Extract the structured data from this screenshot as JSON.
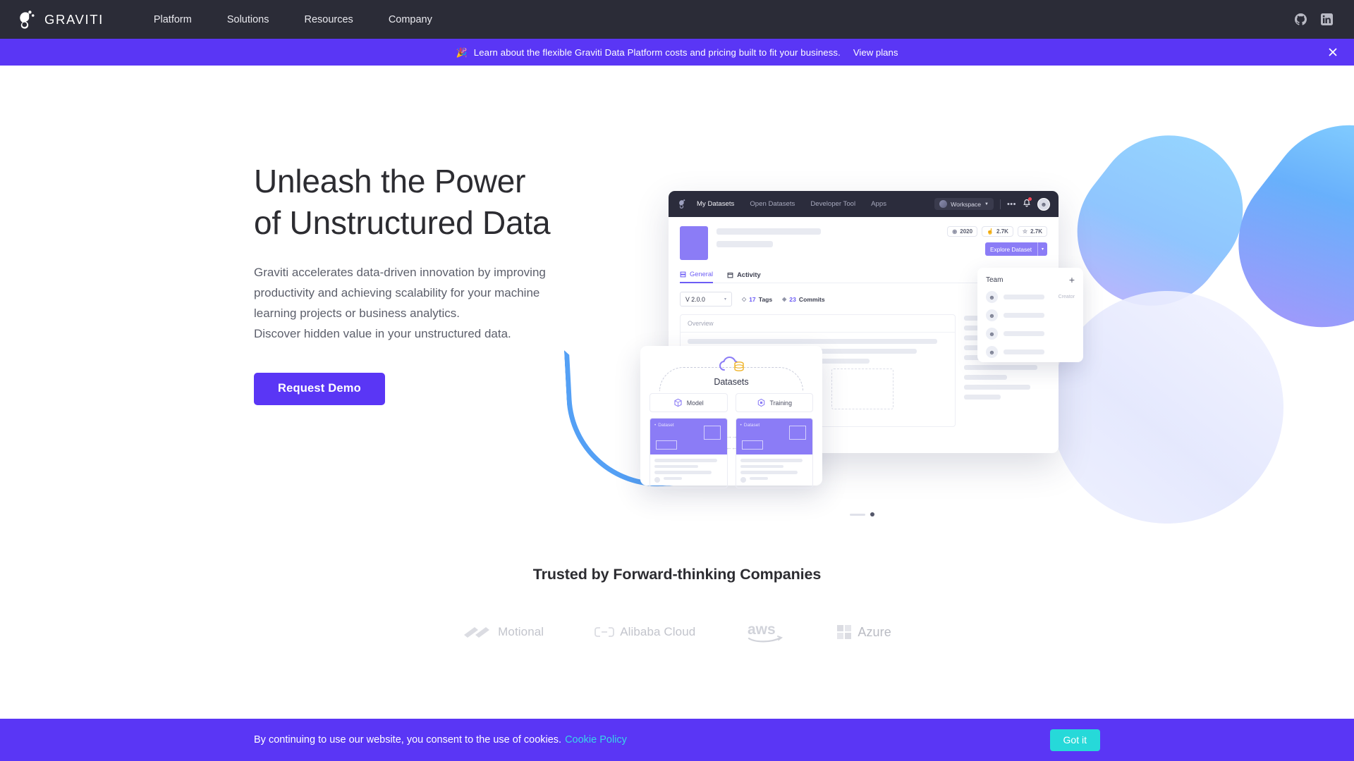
{
  "navbar": {
    "brand_name": "GRAVITI",
    "logo_icon": "graviti-g-logo",
    "links": [
      {
        "label": "Platform"
      },
      {
        "label": "Solutions"
      },
      {
        "label": "Resources"
      },
      {
        "label": "Company"
      }
    ],
    "social": [
      {
        "name": "github-icon"
      },
      {
        "name": "linkedin-icon"
      }
    ]
  },
  "promo_banner": {
    "emoji": "🎉",
    "text": "Learn about the flexible Graviti Data Platform costs and pricing built to fit your business.",
    "link_label": "View plans",
    "close_icon": "close-icon",
    "background_color": "#5a36f5"
  },
  "hero": {
    "title_line1": "Unleash the Power",
    "title_line2": "of Unstructured Data",
    "paragraph_lines": [
      "Graviti accelerates data-driven innovation by improving",
      "productivity and achieving scalability for your machine",
      "learning projects or business analytics.",
      "Discover hidden value in your unstructured data."
    ],
    "cta_label": "Request Demo",
    "cta_color": "#5a36f5"
  },
  "mockup": {
    "nav_items": [
      {
        "label": "My Datasets"
      },
      {
        "label": "Open Datasets"
      },
      {
        "label": "Developer Tool"
      },
      {
        "label": "Apps"
      }
    ],
    "workspace_label": "Workspace",
    "workspace_caret": "▼",
    "more_icon": "•••",
    "bell_icon": "notification-bell-icon",
    "avatar_icon": "user-avatar",
    "stats": [
      {
        "icon": "◉",
        "value": "2020"
      },
      {
        "icon": "☝",
        "value": "2.7K"
      },
      {
        "icon": "☆",
        "value": "2.7K"
      }
    ],
    "explore_label": "Explore Dataset",
    "explore_caret": "▾",
    "tabs": [
      {
        "label": "General",
        "active": true
      },
      {
        "label": "Activity",
        "active": false
      }
    ],
    "version": "V 2.0.0",
    "version_caret": "▾",
    "tags_count": "17",
    "tags_label": "Tags",
    "commits_count": "23",
    "commits_label": "Commits",
    "overview_label": "Overview",
    "team": {
      "title": "Team",
      "add_icon": "+",
      "role_label": "Creator",
      "member_count": 4
    },
    "datasets_card": {
      "title": "Datasets",
      "cloud_icon": "cloud-database-icon",
      "tabs": [
        {
          "label": "Model",
          "icon": "cube-icon"
        },
        {
          "label": "Training",
          "icon": "hexagon-icon"
        }
      ],
      "cards": [
        {
          "label": "Dataset"
        },
        {
          "label": "Dataset"
        }
      ]
    },
    "carousel": {
      "slides": 2,
      "active_index": 1
    }
  },
  "trusted": {
    "title": "Trusted by Forward-thinking Companies",
    "logos": [
      {
        "name": "Motional",
        "icon": "motional-logo"
      },
      {
        "name": "Alibaba Cloud",
        "icon": "alibaba-cloud-logo"
      },
      {
        "name": "aws",
        "icon": "aws-logo"
      },
      {
        "name": "Azure",
        "icon": "azure-logo"
      }
    ]
  },
  "cookie_bar": {
    "text": "By continuing to use our website, you consent to the use of cookies.",
    "link_label": "Cookie Policy",
    "link_color": "#38d6e8",
    "button_label": "Got it",
    "button_color": "#26d9d9"
  }
}
